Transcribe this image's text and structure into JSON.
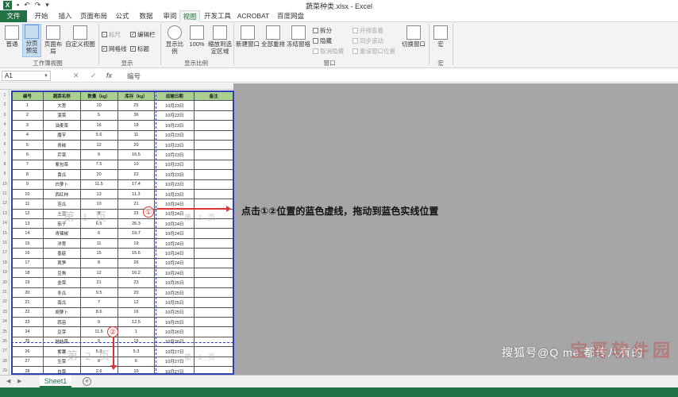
{
  "app": {
    "title": "蔬菜种类.xlsx - Excel",
    "logo": "X",
    "qa_undo": "↶",
    "qa_redo": "↷",
    "qa_save": "▪",
    "qa_more": "▾"
  },
  "tabs": [
    {
      "label": "文件"
    },
    {
      "label": "开始"
    },
    {
      "label": "插入"
    },
    {
      "label": "页面布局"
    },
    {
      "label": "公式"
    },
    {
      "label": "数据"
    },
    {
      "label": "审阅"
    },
    {
      "label": "视图"
    },
    {
      "label": "开发工具"
    },
    {
      "label": "ACROBAT"
    },
    {
      "label": "百度网盘"
    }
  ],
  "active_tab": "视图",
  "ribbon": {
    "workbook_views": {
      "normal": "普通",
      "page_break_preview": "分页预览",
      "page_layout": "页面布局",
      "custom_views": "自定义视图",
      "group_label": "工作簿视图"
    },
    "show": {
      "ruler": "标尺",
      "gridlines": "网格线",
      "formula_bar": "编辑栏",
      "headings": "标题",
      "group_label": "显示"
    },
    "zoom": {
      "zoom": "显示比例",
      "hundred": "100%",
      "zoom_to_selection": "缩放到选定区域",
      "group_label": "显示比例"
    },
    "window": {
      "new_window": "新建窗口",
      "arrange_all": "全部重排",
      "freeze_panes": "冻结窗格",
      "split": "拆分",
      "hide": "隐藏",
      "unhide": "取消隐藏",
      "view_side_by_side": "并排查看",
      "sync_scroll": "同步滚动",
      "reset_position": "重设窗口位置",
      "switch_windows": "切换窗口",
      "group_label": "窗口"
    },
    "macros": {
      "macros": "宏",
      "group_label": "宏"
    }
  },
  "formula_bar": {
    "name_box": "A1",
    "cancel": "✕",
    "confirm": "✓",
    "fx": "fx",
    "value": "编号"
  },
  "sheet": {
    "headers": [
      "编号",
      "蔬菜名称",
      "数量（kg）",
      "库存（kg）",
      "运输日期",
      "备注"
    ],
    "rows": [
      [
        "1",
        "大葱",
        "10",
        "25",
        "10月23日",
        ""
      ],
      [
        "2",
        "菠菜",
        "5",
        "36",
        "10月23日",
        ""
      ],
      [
        "3",
        "油麦菜",
        "16",
        "18",
        "10月23日",
        ""
      ],
      [
        "4",
        "魔芋",
        "5.6",
        "11",
        "10月23日",
        ""
      ],
      [
        "5",
        "青椒",
        "12",
        "20",
        "10月23日",
        ""
      ],
      [
        "6",
        "芹菜",
        "9",
        "16.5",
        "10月23日",
        ""
      ],
      [
        "7",
        "紫包菜",
        "7.5",
        "10",
        "10月23日",
        ""
      ],
      [
        "8",
        "黄瓜",
        "20",
        "22",
        "10月23日",
        ""
      ],
      [
        "9",
        "白萝卜",
        "11.5",
        "17.4",
        "10月23日",
        ""
      ],
      [
        "10",
        "西红柿",
        "13",
        "11.3",
        "10月23日",
        ""
      ],
      [
        "11",
        "苦瓜",
        "10",
        "21",
        "10月24日",
        ""
      ],
      [
        "12",
        "土豆",
        "8",
        "23",
        "10月24日",
        ""
      ],
      [
        "13",
        "茄子",
        "6.5",
        "26.3",
        "10月24日",
        ""
      ],
      [
        "14",
        "青辣椒",
        "6",
        "19.7",
        "10月24日",
        ""
      ],
      [
        "15",
        "洋葱",
        "11",
        "19",
        "10月24日",
        ""
      ],
      [
        "16",
        "香菇",
        "15",
        "15.6",
        "10月24日",
        ""
      ],
      [
        "17",
        "莴笋",
        "8",
        "26",
        "10月24日",
        ""
      ],
      [
        "18",
        "豆角",
        "12",
        "16.2",
        "10月24日",
        ""
      ],
      [
        "19",
        "韭菜",
        "21",
        "23",
        "10月25日",
        ""
      ],
      [
        "20",
        "冬瓜",
        "9.5",
        "20",
        "10月25日",
        ""
      ],
      [
        "21",
        "南瓜",
        "7",
        "12",
        "10月25日",
        ""
      ],
      [
        "22",
        "胡萝卜",
        "8.6",
        "16",
        "10月25日",
        ""
      ],
      [
        "23",
        "蒜苗",
        "9",
        "12.5",
        "10月25日",
        ""
      ],
      [
        "24",
        "豆芽",
        "11.5",
        "1",
        "10月26日",
        ""
      ],
      [
        "25",
        "娃娃菜",
        "9",
        "15",
        "10月26日",
        ""
      ],
      [
        "26",
        "紫薯",
        "5.3",
        "5.3",
        "10月27日",
        ""
      ],
      [
        "27",
        "生菜",
        "6",
        "6",
        "10月27日",
        ""
      ],
      [
        "28",
        "白菜",
        "2.6",
        "10",
        "10月27日",
        ""
      ]
    ],
    "row_numbers": [
      "1",
      "2",
      "3",
      "4",
      "5",
      "6",
      "7",
      "8",
      "9",
      "10",
      "11",
      "12",
      "13",
      "14",
      "15",
      "16",
      "17",
      "18",
      "19",
      "20",
      "21",
      "22",
      "23",
      "24",
      "25",
      "26",
      "27",
      "28",
      "29"
    ],
    "page_watermarks": {
      "page1": "第 1 页",
      "page2": "第 2 页",
      "page3": "第 3 页",
      "page4": "第 4 页"
    }
  },
  "annotation": {
    "marker1": "①",
    "marker2": "②",
    "text": "点击①②位置的蓝色虚线，拖动到蓝色实线位置"
  },
  "sheet_tabs": {
    "active": "Sheet1",
    "add": "+",
    "nav_prev": "◀",
    "nav_next": "▶"
  },
  "watermark": {
    "text1": "搜狐号@Q  me  都传八有的",
    "text2": "宝哥软件园"
  }
}
